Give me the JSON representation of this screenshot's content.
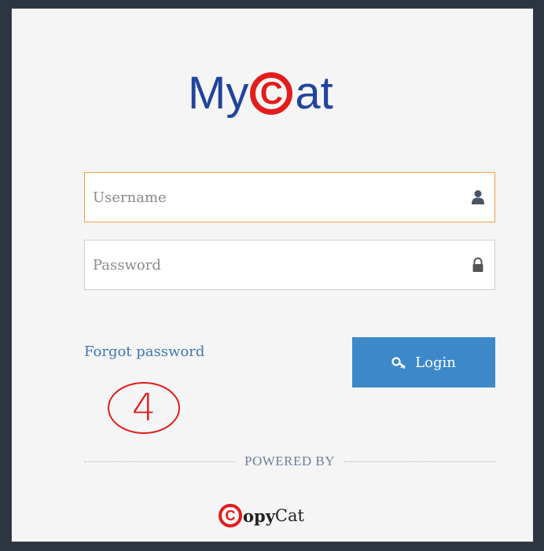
{
  "logo": {
    "prefix": "My",
    "badge_letter": "C",
    "suffix": "at"
  },
  "form": {
    "username": {
      "placeholder": "Username",
      "value": "",
      "icon": "user-icon"
    },
    "password": {
      "placeholder": "Password",
      "value": "",
      "icon": "lock-icon"
    },
    "forgot_label": "Forgot password",
    "login_label": "Login",
    "login_icon": "key-icon"
  },
  "annotation": {
    "step_number": "4",
    "color": "#e31c1c"
  },
  "footer": {
    "powered_by": "POWERED BY",
    "brand_badge_letter": "C",
    "brand_bold": "opy",
    "brand_rest": "Cat"
  },
  "colors": {
    "background": "#2d3542",
    "panel": "#f5f5f5",
    "logo_blue": "#21449c",
    "logo_red": "#e31c1c",
    "button_blue": "#3d88c9",
    "link_blue": "#3f79b0",
    "focus_orange": "#f0a04b"
  }
}
